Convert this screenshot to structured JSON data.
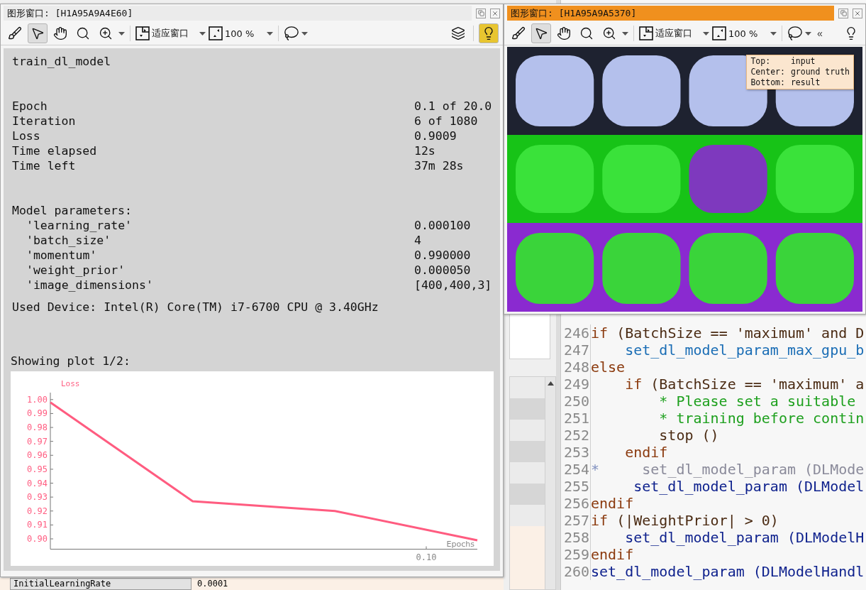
{
  "windows": [
    {
      "title": "图形窗口: [H1A95A9A4E60]",
      "active": false,
      "tools": [
        {
          "kind": "clear"
        },
        {
          "kind": "pointer",
          "selected": true
        },
        {
          "kind": "pan",
          "selected": false
        },
        {
          "kind": "magnify",
          "selected": false
        },
        {
          "kind": "zoom",
          "selected": false
        },
        {
          "kind": "fit",
          "label": "适应窗口"
        },
        {
          "kind": "scale",
          "label": "100 %"
        },
        {
          "kind": "lasso"
        }
      ],
      "end_tools": [
        {
          "kind": "layers"
        },
        {
          "kind": "bulb",
          "on": true
        }
      ]
    },
    {
      "title": "图形窗口: [H1A95A9A5370]",
      "active": true,
      "tools": [
        {
          "kind": "clear"
        },
        {
          "kind": "pointer",
          "selected": true
        },
        {
          "kind": "pan",
          "selected": false
        },
        {
          "kind": "magnify",
          "selected": false
        },
        {
          "kind": "zoom",
          "selected": false
        },
        {
          "kind": "fit",
          "label": "适应窗口"
        },
        {
          "kind": "scale",
          "label": "100 %"
        },
        {
          "kind": "lasso"
        },
        {
          "kind": "collapse",
          "label": "«"
        }
      ],
      "end_tools": [
        {
          "kind": "bulb",
          "on": false
        }
      ]
    }
  ],
  "report": {
    "title": "train_dl_model",
    "stats": [
      {
        "label": "Epoch",
        "value": "0.1 of 20.0"
      },
      {
        "label": "Iteration",
        "value": "6 of 1080"
      },
      {
        "label": "Loss",
        "value": "0.9009"
      },
      {
        "label": "Time elapsed",
        "value": "12s"
      },
      {
        "label": "Time left",
        "value": "37m 28s"
      }
    ],
    "params_heading": "Model parameters:",
    "params": [
      {
        "label": "'learning_rate'",
        "value": "0.000100"
      },
      {
        "label": "'batch_size'",
        "value": "4"
      },
      {
        "label": "'momentum'",
        "value": "0.990000"
      },
      {
        "label": "'weight_prior'",
        "value": "0.000050"
      },
      {
        "label": "'image_dimensions'",
        "value": "[400,400,3]"
      }
    ],
    "device": "Used Device: Intel(R) Core(TM) i7-6700 CPU @ 3.40GHz",
    "plot_caption": "Showing plot 1/2:",
    "chart_data": {
      "type": "line",
      "xlabel": "Epochs",
      "series": [
        {
          "name": "Loss",
          "color": "#ff5c80",
          "values": [
            0.998,
            0.927,
            0.92,
            0.899
          ]
        }
      ],
      "ylim": [
        0.8926,
        1.005
      ],
      "annotations": [
        "0.10"
      ],
      "yticks": [
        {
          "value": 1.0,
          "label": "1.00"
        },
        {
          "value": 0.99,
          "label": "0.99"
        },
        {
          "value": 0.98,
          "label": "0.98"
        },
        {
          "value": 0.97,
          "label": "0.97"
        },
        {
          "value": 0.96,
          "label": "0.96"
        },
        {
          "value": 0.95,
          "label": "0.95"
        },
        {
          "value": 0.94,
          "label": "0.94"
        },
        {
          "value": 0.93,
          "label": "0.93"
        },
        {
          "value": 0.92,
          "label": "0.92"
        },
        {
          "value": 0.91,
          "label": "0.91"
        },
        {
          "value": 0.9,
          "label": "0.90"
        }
      ]
    }
  },
  "viewer": {
    "kind": "picture",
    "legend": [
      {
        "label": "Top:",
        "value": "input"
      },
      {
        "label": "Center:",
        "value": "ground truth"
      },
      {
        "label": "Bottom:",
        "value": "result"
      }
    ]
  },
  "properties": [
    {
      "name": "InitialLearningRate",
      "value": "0.0001"
    }
  ],
  "editor": {
    "lines": [
      {
        "number": "246",
        "tokens": [
          {
            "kind": "keyword",
            "text": "if"
          },
          {
            "kind": "plain",
            "text": " (BatchSize == 'maximum' and D"
          }
        ]
      },
      {
        "number": "247",
        "tokens": [
          {
            "kind": "libproc",
            "text": "    set_dl_model_param_max_gpu_b"
          }
        ]
      },
      {
        "number": "248",
        "tokens": [
          {
            "kind": "keyword",
            "text": "else"
          }
        ]
      },
      {
        "number": "249",
        "tokens": [
          {
            "kind": "keyword",
            "text": "    if"
          },
          {
            "kind": "plain",
            "text": " (BatchSize == 'maximum' a"
          }
        ]
      },
      {
        "number": "250",
        "tokens": [
          {
            "kind": "comment",
            "text": "        * Please set a suitable"
          }
        ]
      },
      {
        "number": "251",
        "tokens": [
          {
            "kind": "comment",
            "text": "        * training before contin"
          }
        ]
      },
      {
        "number": "252",
        "tokens": [
          {
            "kind": "plain",
            "text": "        stop ()"
          }
        ]
      },
      {
        "number": "253",
        "tokens": [
          {
            "kind": "keyword",
            "text": "    endif"
          }
        ]
      },
      {
        "number": "254",
        "tokens": [
          {
            "kind": "marker",
            "text": "*"
          },
          {
            "kind": "disabled",
            "text": "     set_dl_model_param (DLMode"
          }
        ]
      },
      {
        "number": "255",
        "tokens": [
          {
            "kind": "proc",
            "text": "     set_dl_model_param (DLModel"
          }
        ]
      },
      {
        "number": "256",
        "tokens": [
          {
            "kind": "keyword",
            "text": "endif"
          }
        ]
      },
      {
        "number": "257",
        "tokens": [
          {
            "kind": "keyword",
            "text": "if"
          },
          {
            "kind": "plain",
            "text": " (|WeightPrior| > 0)"
          }
        ]
      },
      {
        "number": "258",
        "tokens": [
          {
            "kind": "proc",
            "text": "    set_dl_model_param (DLModelH"
          }
        ]
      },
      {
        "number": "259",
        "tokens": [
          {
            "kind": "keyword",
            "text": "endif"
          }
        ]
      },
      {
        "number": "260",
        "tokens": [
          {
            "kind": "proc",
            "text": "set_dl_model_param (DLModelHandl"
          }
        ]
      }
    ]
  }
}
